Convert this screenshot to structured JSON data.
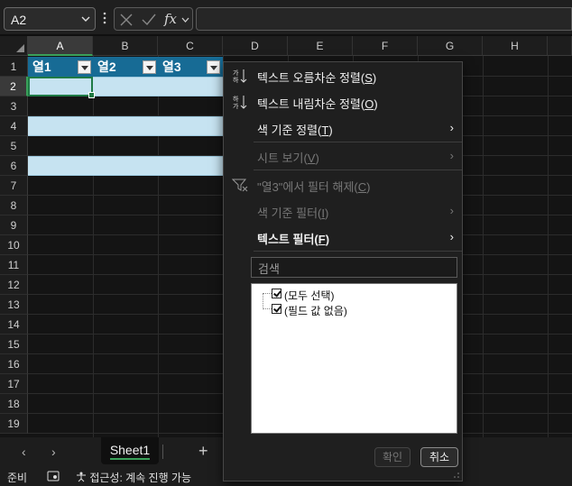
{
  "formula_bar": {
    "name_box": "A2",
    "fx_label": "fx",
    "formula": ""
  },
  "grid": {
    "columns": [
      "A",
      "B",
      "C",
      "D",
      "E",
      "F",
      "G",
      "H"
    ],
    "rows": [
      "1",
      "2",
      "3",
      "4",
      "5",
      "6",
      "7",
      "8",
      "9",
      "10",
      "11",
      "12",
      "13",
      "14",
      "15",
      "16",
      "17",
      "18",
      "19"
    ],
    "selected_column": "A",
    "selected_row": "2",
    "table_headers": [
      "열1",
      "열2",
      "열3"
    ]
  },
  "menu": {
    "sort_asc": {
      "text": "텍스트 오름차순 정렬(",
      "key": "S",
      "end": ")"
    },
    "sort_desc": {
      "text": "텍스트 내림차순 정렬(",
      "key": "O",
      "end": ")"
    },
    "sort_by_color": {
      "text": "색 기준 정렬(",
      "key": "T",
      "end": ")"
    },
    "sheet_view": {
      "text": "시트 보기(",
      "key": "V",
      "end": ")"
    },
    "clear_filter": {
      "text": "\"열3\"에서 필터 해제(",
      "key": "C",
      "end": ")"
    },
    "filter_by_color": {
      "text": "색 기준 필터(",
      "key": "I",
      "end": ")"
    },
    "text_filter": {
      "text": "텍스트 필터(",
      "key": "F",
      "end": ")"
    },
    "search_placeholder": "검색",
    "list_items": [
      "(모두 선택)",
      "(필드 값 없음)"
    ],
    "ok_label": "확인",
    "cancel_label": "취소"
  },
  "sheets": {
    "active": "Sheet1"
  },
  "status": {
    "ready": "준비",
    "accessibility": "접근성: 계속 진행 가능"
  },
  "colors": {
    "table_header": "#176b95",
    "table_band": "#c6e3f1",
    "selection": "#1e7a45"
  }
}
